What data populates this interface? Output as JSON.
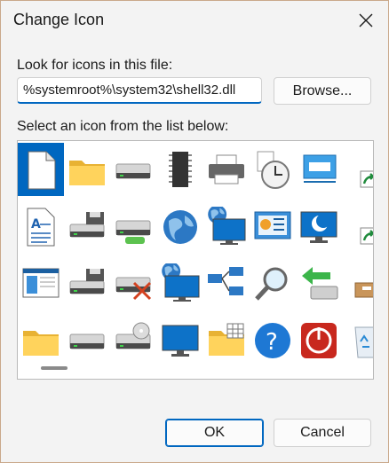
{
  "window": {
    "title": "Change Icon",
    "close_icon": "close-icon"
  },
  "file_section": {
    "label": "Look for icons in this file:",
    "path_value": "%systemroot%\\system32\\shell32.dll",
    "browse_label": "Browse..."
  },
  "list_section": {
    "label": "Select an icon from the list below:",
    "selected_index": 0,
    "icons": [
      "blank-document-icon",
      "folder-icon",
      "drive-icon",
      "chip-icon",
      "printer-icon",
      "clock-icon",
      "window-icon",
      "shortcut-arrow-icon",
      "text-document-icon",
      "floppy-drive-icon",
      "usb-drive-icon",
      "globe-icon",
      "network-globe-monitor-icon",
      "control-panel-icon",
      "moon-monitor-icon",
      "shortcut-arrow-icon",
      "application-window-icon",
      "floppy-drive-icon",
      "disconnected-drive-icon",
      "globe-monitor-icon",
      "network-icon",
      "search-icon",
      "install-arrow-icon",
      "package-icon",
      "folder-icon",
      "drive-icon",
      "cd-drive-icon",
      "monitor-icon",
      "pictures-folder-icon",
      "help-icon",
      "power-icon",
      "recycle-bin-icon"
    ]
  },
  "buttons": {
    "ok_label": "OK",
    "cancel_label": "Cancel"
  },
  "colors": {
    "accent": "#0067c0",
    "background": "#f3f3f3",
    "window_border": "#c9a88a"
  }
}
